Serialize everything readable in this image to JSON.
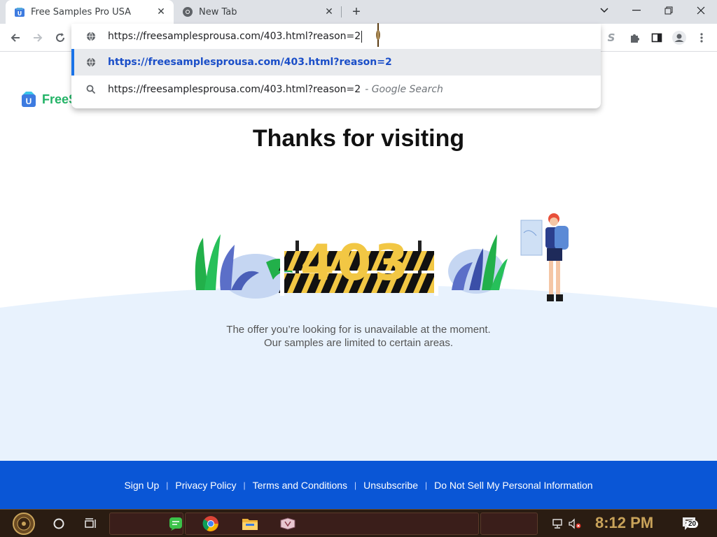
{
  "browser": {
    "tabs": [
      {
        "title": "Free Samples Pro USA",
        "active": true
      },
      {
        "title": "New Tab",
        "active": false
      }
    ],
    "address_bar": {
      "value": "https://freesamplesprousa.com/403.html?reason=2",
      "suggestions": [
        {
          "text": "https://freesamplesprousa.com/403.html?reason=2",
          "type": "url"
        },
        {
          "text": "https://freesamplesprousa.com/403.html?reason=2",
          "suffix": "- Google Search",
          "type": "search"
        }
      ]
    },
    "colors": {
      "tabstrip": "#dee1e6",
      "accent": "#1a73e8"
    }
  },
  "page": {
    "logo_text": "FreeS",
    "headline": "Thanks for visiting",
    "error_code": "403",
    "message_line1": "The offer you’re looking for is unavailable at the moment.",
    "message_line2": "Our samples are limited to certain areas.",
    "footer_links": [
      "Sign Up",
      "Privacy Policy",
      "Terms and Conditions",
      "Unsubscribe",
      "Do Not Sell My Personal Information"
    ],
    "colors": {
      "footer": "#0a56d6",
      "logo_green": "#22b366",
      "wave": "#e8f2fd"
    }
  },
  "taskbar": {
    "clock": "8:12 PM",
    "notification_count": "20",
    "icons": [
      "start-orb-icon",
      "search-circle-icon",
      "task-view-icon",
      "chat-app-icon",
      "chrome-icon",
      "file-explorer-icon",
      "app-icon",
      "network-icon",
      "volume-muted-icon",
      "notification-icon"
    ]
  }
}
